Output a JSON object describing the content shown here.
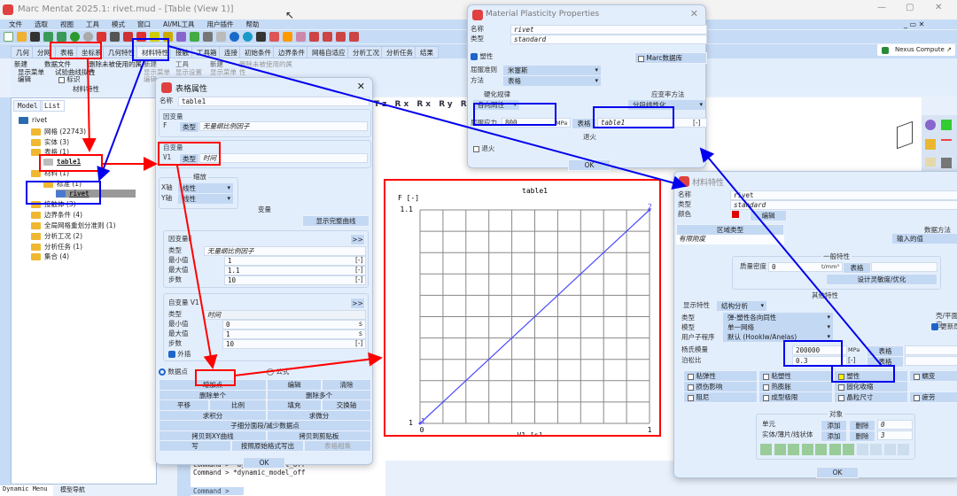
{
  "window": {
    "title": "Marc Mentat 2025.1: rivet.mud - [Table (View 1)]",
    "min": "—",
    "max": "▢",
    "close": "✕"
  },
  "menu": [
    "文件",
    "选取",
    "视图",
    "工具",
    "模式",
    "窗口",
    "AI/ML工具",
    "用户插件",
    "帮助"
  ],
  "tabs": [
    "几何",
    "分网",
    "表格",
    "坐标系",
    "几何特性",
    "材料特性",
    "接触",
    "工具箱",
    "连接",
    "初始条件",
    "边界条件",
    "网格自适应",
    "分析工况",
    "分析任务",
    "结果"
  ],
  "nexus": "Nexus Compute",
  "ribbon": {
    "new1": "新建",
    "datafile": "数据文件",
    "show_menu": "显示菜单",
    "fit": "试验曲线拟合",
    "edit": "编辑",
    "mark": "标识",
    "delete_unused": "删除未被使用的属性",
    "group": "材料特性",
    "new2": "新建",
    "tools": "工具",
    "show_menu2": "显示菜单",
    "show_settings": "显示设置",
    "edit2": "编辑",
    "new3": "新建",
    "show_menu3": "显示菜单",
    "delete_unused2": "删除未被使用的属性"
  },
  "panel": {
    "tab_model": "Model",
    "tab_list": "List",
    "bottom_tab1": "Dynamic Menu",
    "bottom_tab2": "模型导航",
    "tree": [
      {
        "label": "rivet",
        "lvl": 0
      },
      {
        "label": "网格 (22743)",
        "lvl": 1
      },
      {
        "label": "实体 (3)",
        "lvl": 1
      },
      {
        "label": "表格 (1)",
        "lvl": 1
      },
      {
        "label": "table1",
        "lvl": 2
      },
      {
        "label": "材料 (1)",
        "lvl": 1
      },
      {
        "label": "标准 (1)",
        "lvl": 2
      },
      {
        "label": "rivet",
        "lvl": 3
      },
      {
        "label": "接触体 (3)",
        "lvl": 1
      },
      {
        "label": "边界条件 (4)",
        "lvl": 1
      },
      {
        "label": "全局网格重划分准则 (1)",
        "lvl": 1
      },
      {
        "label": "分析工况 (2)",
        "lvl": 1
      },
      {
        "label": "分析任务 (1)",
        "lvl": 1
      },
      {
        "label": "集合 (4)",
        "lvl": 1
      }
    ]
  },
  "table_dialog": {
    "title": "表格属性",
    "name_label": "名称",
    "name": "table1",
    "dep_title": "因变量",
    "dep_var": "F",
    "type_btn": "类型",
    "dep_type": "无量纲比例因子",
    "indep_title": "自变量",
    "indep_var": "V1",
    "indep_type": "时间",
    "scale_title": "缩放",
    "xaxis": "X轴",
    "yaxis": "Y轴",
    "linear": "线性",
    "vars_title": "变量",
    "show_full": "显示完整曲线",
    "dep_box": {
      "title": "因变量F",
      "type_label": "类型",
      "type": "无量纲比例因子",
      "min_label": "最小值",
      "min": "1",
      "max_label": "最大值",
      "max": "1.1",
      "steps_label": "步数",
      "steps": "10",
      "unit": "[-]"
    },
    "indep_box": {
      "title": "自变量 V1",
      "type_label": "类型",
      "type": "时间",
      "min_label": "最小值",
      "min": "0",
      "max_label": "最大值",
      "max": "1",
      "steps_label": "步数",
      "steps": "10",
      "unit_s": "s",
      "unit": "[-]",
      "extrap": "外插"
    },
    "more": ">>",
    "radio_points": "数据点",
    "radio_formula": "公式",
    "buttons": [
      "增加点",
      "编辑",
      "清除",
      "删除单个",
      "删除多个",
      "平移",
      "比例",
      "填充",
      "交换轴",
      "求积分",
      "求微分",
      "子细分面段/减少数据点",
      "拷贝到XY曲线",
      "拷贝到剪贴板",
      "写",
      "按照原始格式写出",
      "表格相乘"
    ],
    "ok": "OK"
  },
  "command": {
    "lines": [
      "Command > *dynamic_model_off",
      "Command > *dynamic_model_off"
    ],
    "prompt": "Command >"
  },
  "chart_data": {
    "type": "line",
    "title": "table1",
    "xlabel": "V1 [s]",
    "ylabel": "F [-]",
    "xlim": [
      0,
      1
    ],
    "ylim": [
      1,
      1.1
    ],
    "x_ticks": [
      "0",
      "1"
    ],
    "y_ticks": [
      "1",
      "1.1"
    ],
    "grid": true,
    "series": [
      {
        "name": "table1",
        "x": [
          0,
          1
        ],
        "y": [
          1,
          1.1
        ],
        "point_labels": [
          "1",
          "2"
        ],
        "color": "#4a4aff"
      }
    ]
  },
  "plasticity_dialog": {
    "title": "Material Plasticity Properties",
    "name_label": "名称",
    "name": "rivet",
    "type_label": "类型",
    "type": "standard",
    "plastic": "塑性",
    "marc_db": "Marc数据库",
    "yield_label": "屈服准则",
    "yield": "米塞斯",
    "method_label": "方法",
    "method": "表格",
    "hardening_title": "硬化规律",
    "hardening": "各向同性",
    "strain_title": "应变率方法",
    "strain": "分段线性化",
    "stress_label": "屈服应力",
    "stress": "800",
    "stress_unit": "MPa",
    "table_btn": "表格",
    "table": "table1",
    "table_unit": "[-]",
    "anneal_title": "退火",
    "anneal": "退火",
    "ok": "OK"
  },
  "material_dialog": {
    "title": "材料特性",
    "name_label": "名称",
    "name": "rivet",
    "type_label": "类型",
    "type": "standard",
    "color_label": "颜色",
    "color": "#e00000",
    "edit": "编辑",
    "region_btn": "区域类型",
    "region": "有限刚度",
    "data_method_title": "数据方法",
    "data_method": "输入的值",
    "general_title": "一般特性",
    "density_label": "质量密度",
    "density": "0",
    "density_unit": "t/mm³",
    "table_btn": "表格",
    "design": "设计灵敏度/优化",
    "other_title": "其他特性",
    "display_label": "显示特性",
    "display": "结构分析",
    "type2_label": "类型",
    "type2": "弹-塑性各向同性",
    "model_label": "模型",
    "model": "单一网络",
    "user_label": "用户子程序",
    "user": "默认 (Hooklw/Anelas)",
    "shell_title": "壳/平面应",
    "update": "更新厚",
    "young_label": "杨氏模量",
    "young": "200000",
    "young_unit": "MPa",
    "poisson_label": "泊松比",
    "poisson": "0.3",
    "poisson_unit": "[-]",
    "props": [
      "粘弹性",
      "粘塑性",
      "塑性",
      "蠕变",
      "损伤影响",
      "热膨胀",
      "固化收缩",
      "",
      "阻尼",
      "成型极限",
      "晶粒尺寸",
      "疲劳"
    ],
    "objects_title": "对象",
    "elements": "单元",
    "solids": "实体/薄片/线状体",
    "add": "添加",
    "remove": "删除",
    "elem_count": "0",
    "solid_count": "3",
    "ok": "OK"
  },
  "annotation_colors": {
    "red": "#ff0000",
    "blue": "#0000ee"
  }
}
